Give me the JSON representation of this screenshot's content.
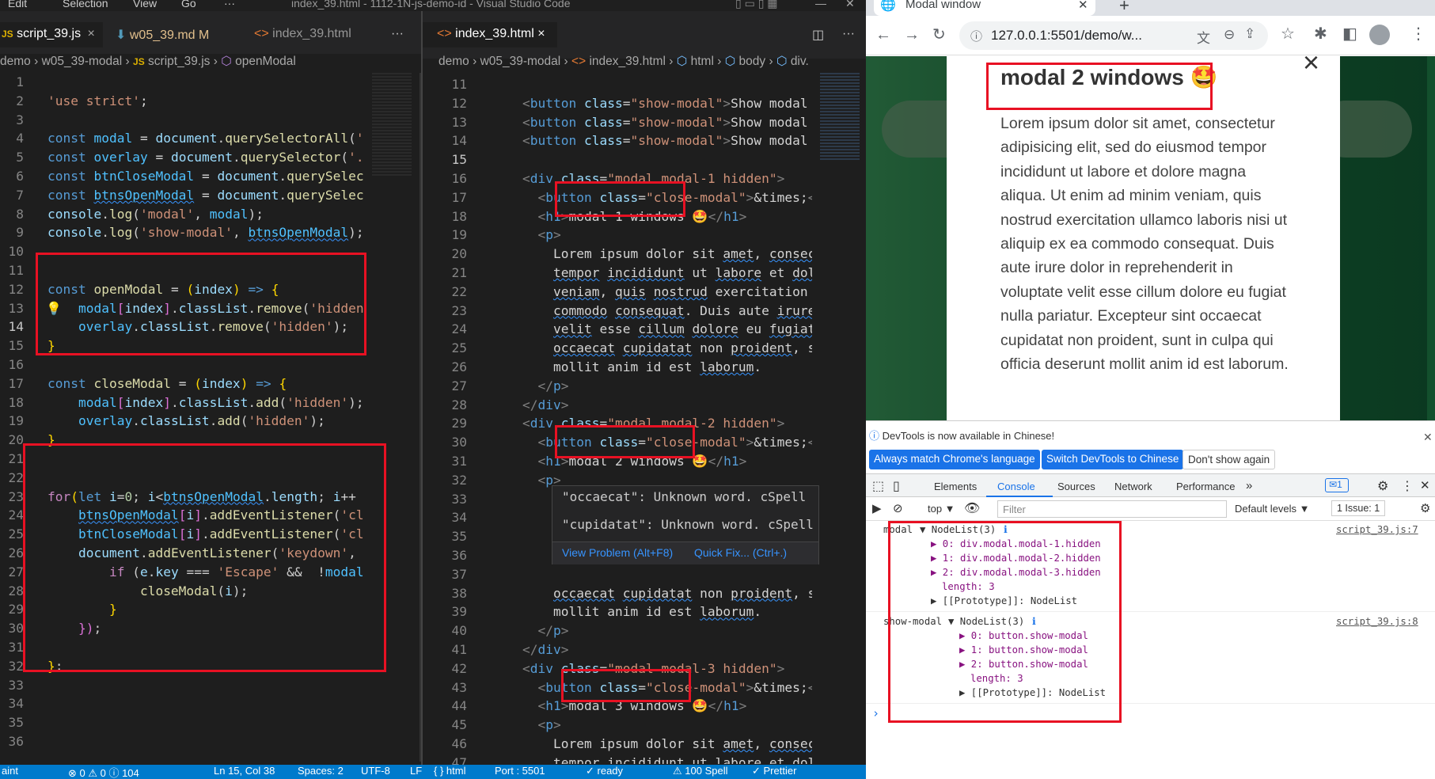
{
  "vscode": {
    "menu": [
      "Edit",
      "Selection",
      "View",
      "Go",
      "···"
    ],
    "window_title": "index_39.html - 1112-1N-js-demo-id - Visual Studio Code",
    "left_tabs": [
      {
        "label": "script_39.js",
        "modified": "",
        "icon": "JS"
      },
      {
        "label": "w05_39.md",
        "modified": "M",
        "icon": "markdown"
      },
      {
        "label": "index_39.html",
        "modified": "",
        "icon": "<>"
      }
    ],
    "left_breadcrumb": [
      "demo",
      "w05_39-modal",
      "script_39.js",
      "openModal"
    ],
    "right_tab": {
      "label": "index_39.html",
      "close": "×"
    },
    "right_breadcrumb": [
      "demo",
      "w05_39-modal",
      "index_39.html",
      "html",
      "body",
      "div."
    ],
    "left_code_lines": [
      "'use strict';",
      "",
      "const modal = document.querySelectorAll('.",
      "const overlay = document.querySelector('.o",
      "const btnCloseModal = document.querySelect",
      "const btnsOpenModal = document.querySelect",
      "console.log('modal', modal);",
      "console.log('show-modal', btnsOpenModal);",
      "",
      "",
      "const openModal = (index) => {",
      "    modal[index].classList.remove('hidden'",
      "    overlay.classList.remove('hidden');",
      "}",
      "",
      "const closeModal = (index) => {",
      "    modal[index].classList.add('hidden');",
      "    overlay.classList.add('hidden');",
      "}",
      "",
      "",
      "for(let i=0; i<btnsOpenModal.length; i++ )",
      "    btnsOpenModal[i].addEventListener('cli",
      "    btnCloseModal[i].addEventListener('cli",
      "    document.addEventListener('keydown', (",
      "        if (e.key === 'Escape' &&  !modal[",
      "            closeModal(i);",
      "        }",
      "    });",
      "",
      "};",
      "",
      "",
      "",
      "",
      ""
    ],
    "right_line_start": 11,
    "right_code_lines": [
      "<button class=\"show-modal\">Show modal",
      "<button class=\"show-modal\">Show modal",
      "<button class=\"show-modal\">Show modal",
      "",
      "<div class=\"modal modal-1 hidden\">",
      "  <button class=\"close-modal\">&times;</",
      "  <h1>modal 1 windows 🤩</h1>",
      "  <p>",
      "    Lorem ipsum dolor sit amet, consec",
      "    tempor incididunt ut labore et dol",
      "    veniam, quis nostrud exercitation ",
      "    commodo consequat. Duis aute irure",
      "    velit esse cillum dolore eu fugiat",
      "    occaecat cupidatat non proident, s",
      "    mollit anim id est laborum.",
      "  </p>",
      "</div>",
      "<div class=\"modal modal-2 hidden\">",
      "  <button class=\"close-modal\">&times;</",
      "  <h1>modal 2 windows 🤩</h1>",
      "  <p>",
      "    Lorem ipsum dolor sit amet, consec",
      "",
      "",
      "",
      "",
      "    occaecat cupidatat non proident, s",
      "    mollit anim id est laborum.",
      "  </p>",
      "</div>",
      "<div class=\"modal modal-3 hidden\">",
      "  <button class=\"close-modal\">&times;</",
      "  <h1>modal 3 windows 🤩</h1>",
      "  <p>",
      "    Lorem ipsum dolor sit amet, consec",
      "    tempor incididunt ut labore et dol",
      "    veniam, quis nostrud exercitation "
    ],
    "hover_popup": {
      "lines": [
        "\"occaecat\": Unknown word. cSpell",
        "\"cupidatat\": Unknown word. cSpell"
      ],
      "actions": [
        "View Problem (Alt+F8)",
        "Quick Fix... (Ctrl+.)"
      ]
    },
    "status": [
      "aint",
      "⊗ 0 ⚠ 0 ⓘ 104",
      "Ln 15, Col 38",
      "Spaces: 2",
      "UTF-8",
      "LF",
      "{ } html",
      "Port : 5501",
      "✓ ready",
      "⚠ 100 Spell",
      "✓ Prettier"
    ]
  },
  "chrome": {
    "tab_title": "Modal window",
    "address": "127.0.0.1:5501/demo/w...",
    "modal": {
      "title": "modal 2 windows 🤩",
      "close": "×",
      "body": "Lorem ipsum dolor sit amet, consectetur adipisicing elit, sed do eiusmod tempor incididunt ut labore et dolore magna aliqua. Ut enim ad minim veniam, quis nostrud exercitation ullamco laboris nisi ut aliquip ex ea commodo consequat. Duis aute irure dolor in reprehenderit in voluptate velit esse cillum dolore eu fugiat nulla pariatur. Excepteur sint occaecat cupidatat non proident, sunt in culpa qui officia deserunt mollit anim id est laborum."
    },
    "devtools": {
      "notice": "DevTools is now available in Chinese!",
      "buttons": [
        "Always match Chrome's language",
        "Switch DevTools to Chinese",
        "Don't show again"
      ],
      "tabs": [
        "Elements",
        "Console",
        "Sources",
        "Network",
        "Performance",
        "»"
      ],
      "badge": "1",
      "context": "top ▼",
      "filter_placeholder": "Filter",
      "levels": "Default levels ▼",
      "issues": "1 Issue:  1",
      "log1": {
        "label": "modal",
        "head": "▼ NodeList(3)",
        "items": [
          "▶ 0: div.modal.modal-1.hidden",
          "▶ 1: div.modal.modal-2.hidden",
          "▶ 2: div.modal.modal-3.hidden"
        ],
        "length": "length: 3",
        "proto": "▶ [[Prototype]]: NodeList",
        "source": "script_39.js:7"
      },
      "log2": {
        "label": "show-modal",
        "head": "▼ NodeList(3)",
        "items": [
          "▶ 0: button.show-modal",
          "▶ 1: button.show-modal",
          "▶ 2: button.show-modal"
        ],
        "length": "length: 3",
        "proto": "▶ [[Prototype]]: NodeList",
        "source": "script_39.js:8"
      },
      "prompt": "›"
    }
  },
  "colors": {
    "annotation_red": "#e81123",
    "vscode_bg": "#1e1e1e",
    "status_blue": "#007acc",
    "page_green": "#1a6b3c"
  }
}
